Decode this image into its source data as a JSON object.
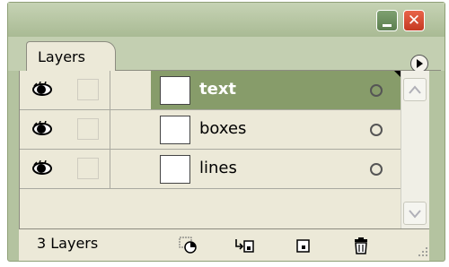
{
  "panel": {
    "tab_label": "Layers",
    "layers": [
      {
        "name": "text",
        "visible": true,
        "selected": true
      },
      {
        "name": "boxes",
        "visible": true,
        "selected": false
      },
      {
        "name": "lines",
        "visible": true,
        "selected": false
      }
    ],
    "layer_count_label": "3 Layers"
  },
  "icons": {
    "minimize": "minimize-icon",
    "close": "close-icon",
    "panel_menu": "panel-menu-icon",
    "visibility": "eye-icon",
    "target": "target-circle-icon",
    "make_clipping_mask": "clipping-mask-icon",
    "new_sublayer": "new-sublayer-icon",
    "new_layer": "new-layer-icon",
    "delete": "trash-icon"
  },
  "colors": {
    "frame": "#b4c3a0",
    "selected_row": "#879c6a",
    "close_button": "#d84a31",
    "minimize_button": "#6d9060"
  }
}
